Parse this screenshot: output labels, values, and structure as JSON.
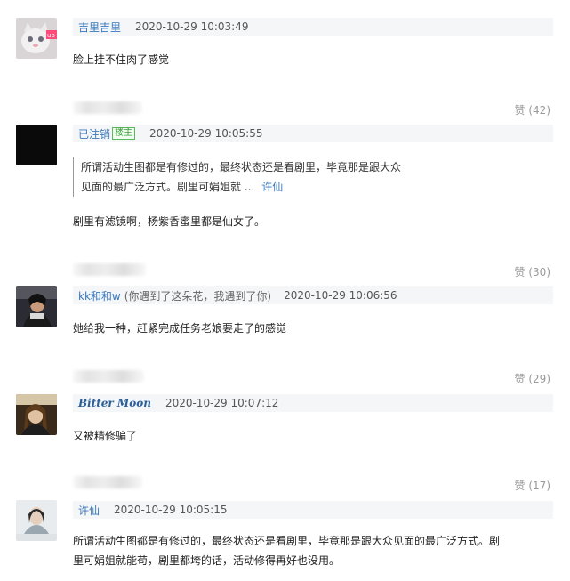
{
  "comments": [
    {
      "username": "吉里吉里",
      "timestamp": "2020-10-29 10:03:49",
      "text": "脸上挂不住肉了感觉",
      "like_label": "赞 (42)"
    },
    {
      "username": "已注销",
      "badge": "楼主",
      "timestamp": "2020-10-29 10:05:55",
      "quote_line1": "所谓活动生图都是有修过的，最终状态还是看剧里，毕竟那是跟大众",
      "quote_line2": "见面的最广泛方式。剧里可娟姐就 ...",
      "quote_author": "许仙",
      "text": "剧里有滤镜啊，杨紫香蜜里都是仙女了。",
      "like_label": "赞 (30)"
    },
    {
      "username": "kk和和w",
      "reply_to": "(你遇到了这朵花，我遇到了你)",
      "timestamp": "2020-10-29 10:06:56",
      "text": "她给我一种，赶紧完成任务老娘要走了的感觉",
      "like_label": "赞 (29)"
    },
    {
      "username": "Bitter Moon",
      "timestamp": "2020-10-29 10:07:12",
      "text": "又被精修骗了",
      "like_label": "赞 (17)"
    },
    {
      "username": "许仙",
      "timestamp": "2020-10-29 10:05:15",
      "text_line1": "所谓活动生图都是有修过的，最终状态还是看剧里，毕竟那是跟大众见面的最广泛方式。剧",
      "text_line2": "里可娟姐就能苟，剧里都垮的话，活动修得再好也没用。"
    }
  ],
  "colors": {
    "username": "#3a7abf",
    "header_bg": "#f4f6f7",
    "badge_border": "#5cb85c",
    "like_text": "#999999"
  }
}
